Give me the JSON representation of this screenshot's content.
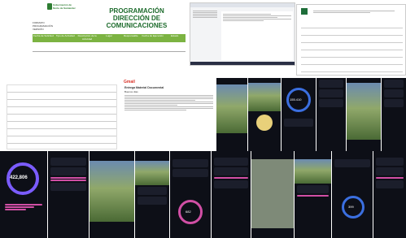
{
  "top_doc": {
    "program_label": "PROGRAMACIÓN",
    "direction_label": "DIRECCIÓN DE COMUNICACIONES",
    "logo_text": "Gobernación de Norte de Santander",
    "small_lines": [
      "FORMATO",
      "PROGRAMACIÓN",
      "VERSIÓN"
    ],
    "columns": [
      "Fecha de Solicitud",
      "Tipo de Actividad",
      "Descripción de la Actividad",
      "Lugar",
      "Responsable",
      "Fecha de Ejecución",
      "Estado"
    ]
  },
  "email": {
    "app_label": "Gmail",
    "subject": "Entrega Material Documental",
    "greeting": "Buenos días"
  },
  "dark_screens": {
    "total_value": "422,806",
    "gauge_value": "155.410",
    "gauge_right": "682",
    "gauge_bottom": "399"
  },
  "colors": {
    "green_bar": "#7cb342",
    "dark_bg": "#0d0f17",
    "accent_pink": "#d14fa5",
    "accent_blue": "#3b6fe0"
  }
}
